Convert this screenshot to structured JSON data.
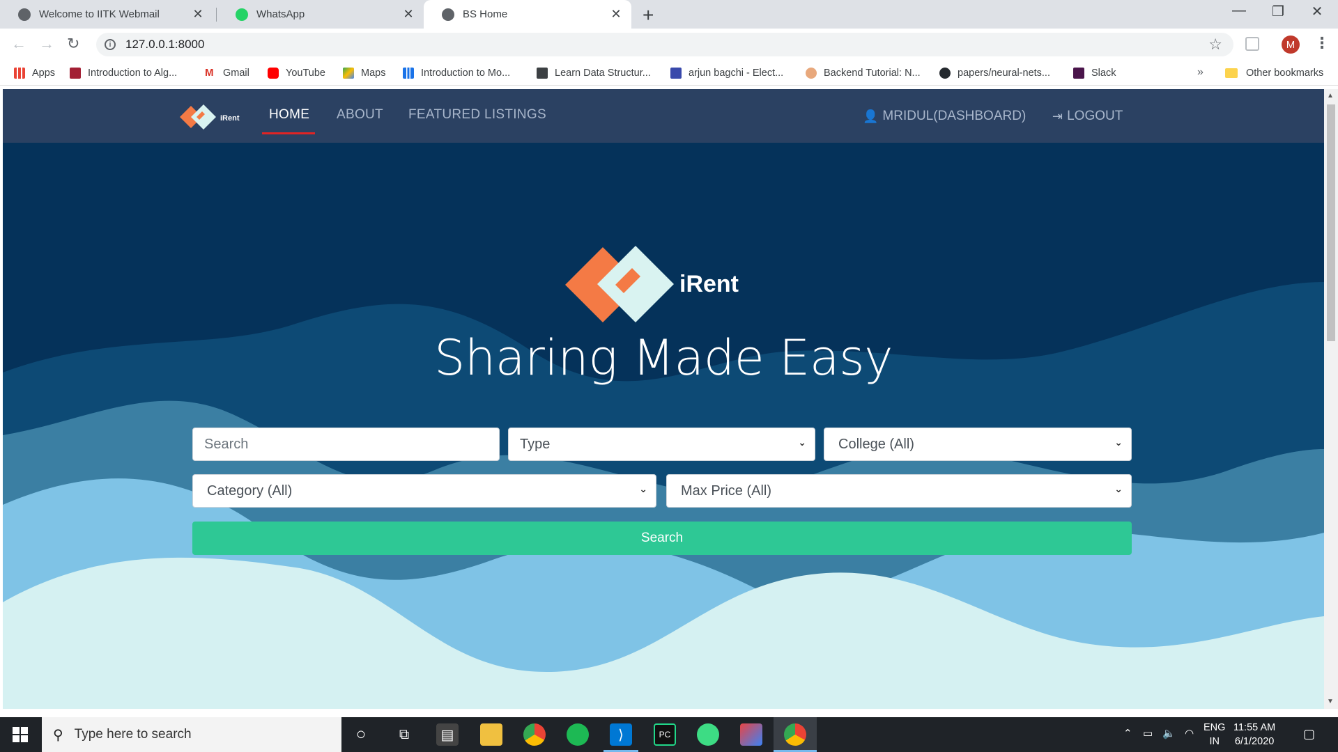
{
  "browser": {
    "tabs": [
      {
        "title": "Welcome to IITK Webmail",
        "favicon": "globe-icon"
      },
      {
        "title": "WhatsApp",
        "favicon": "whatsapp-icon"
      },
      {
        "title": "BS Home",
        "favicon": "globe-icon",
        "active": true
      }
    ],
    "url": "127.0.0.1:8000",
    "profile_initial": "M",
    "bookmarks": [
      {
        "label": "Apps",
        "icon": "apps-grid-icon"
      },
      {
        "label": "Introduction to Alg...",
        "icon": "mit-ocw-icon"
      },
      {
        "label": "Gmail",
        "icon": "gmail-icon"
      },
      {
        "label": "YouTube",
        "icon": "youtube-icon"
      },
      {
        "label": "Maps",
        "icon": "maps-icon"
      },
      {
        "label": "Introduction to Mo...",
        "icon": "chart-icon"
      },
      {
        "label": "Learn Data Structur...",
        "icon": "cc-icon"
      },
      {
        "label": "arjun bagchi - Elect...",
        "icon": "calendar-icon"
      },
      {
        "label": "Backend Tutorial: N...",
        "icon": "avatar-icon"
      },
      {
        "label": "papers/neural-nets...",
        "icon": "github-icon"
      },
      {
        "label": "Slack",
        "icon": "slack-icon"
      }
    ],
    "bookmarks_more": "»",
    "other_bookmarks": "Other bookmarks"
  },
  "site": {
    "nav": {
      "logo_text": "iRent",
      "links": [
        "HOME",
        "ABOUT",
        "FEATURED LISTINGS"
      ],
      "dashboard": "MRIDUL(DASHBOARD)",
      "logout": "LOGOUT"
    },
    "hero": {
      "logo_text": "iRent",
      "title": "Sharing Made Easy"
    },
    "search_form": {
      "search_placeholder": "Search",
      "type_select": "Type",
      "college_select": "College (All)",
      "category_select": "Category (All)",
      "max_price_select": "Max Price (All)",
      "submit_label": "Search"
    }
  },
  "taskbar": {
    "search_placeholder": "Type here to search",
    "lang_top": "ENG",
    "lang_bottom": "IN",
    "time": "11:55 AM",
    "date": "6/1/2020"
  },
  "colors": {
    "nav_bg": "#2b4162",
    "hero_bg": "#05325a",
    "accent_green": "#2ec895",
    "logo_orange": "#f47a45",
    "logo_light": "#d9f3f1",
    "nav_active_underline": "#e02424"
  }
}
